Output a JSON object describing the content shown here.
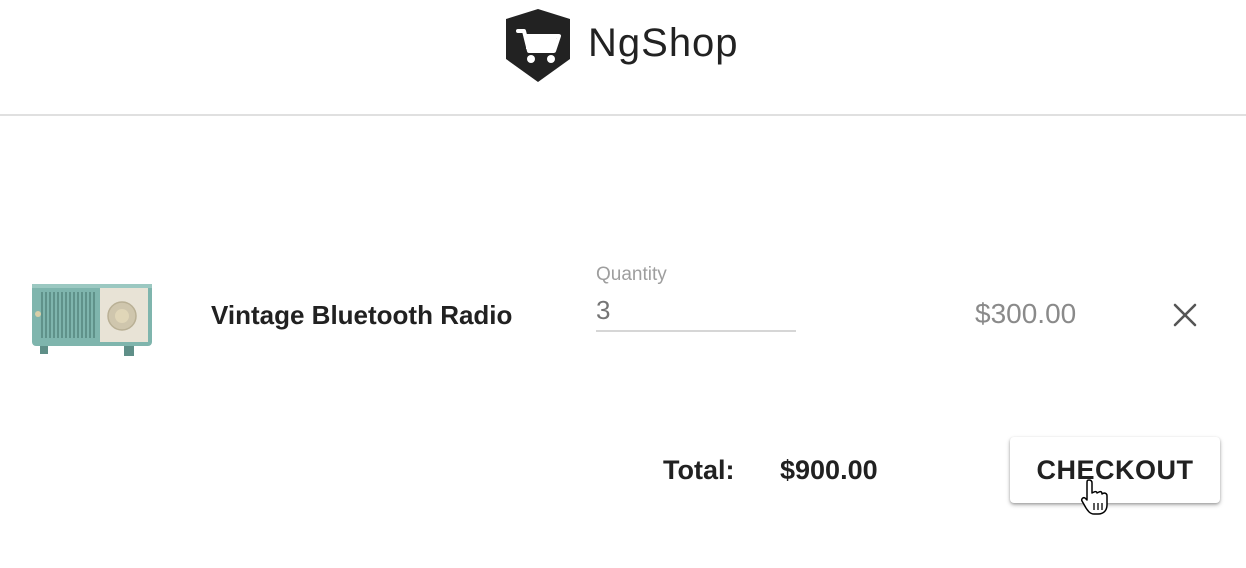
{
  "header": {
    "brand_name": "NgShop",
    "logo_icon": "shopping-cart-shield-icon"
  },
  "cart": {
    "items": [
      {
        "name": "Vintage Bluetooth Radio",
        "image_icon": "vintage-radio-image",
        "quantity_label": "Quantity",
        "quantity_value": "3",
        "price": "$300.00",
        "remove_icon": "close-icon"
      }
    ]
  },
  "summary": {
    "total_label": "Total:",
    "total_value": "$900.00",
    "checkout_label": "CHECKOUT"
  },
  "colors": {
    "logo_bg": "#222222",
    "divider": "#e0e0e0",
    "muted_text": "#9e9e9e",
    "radio_body": "#7fb5ad"
  }
}
